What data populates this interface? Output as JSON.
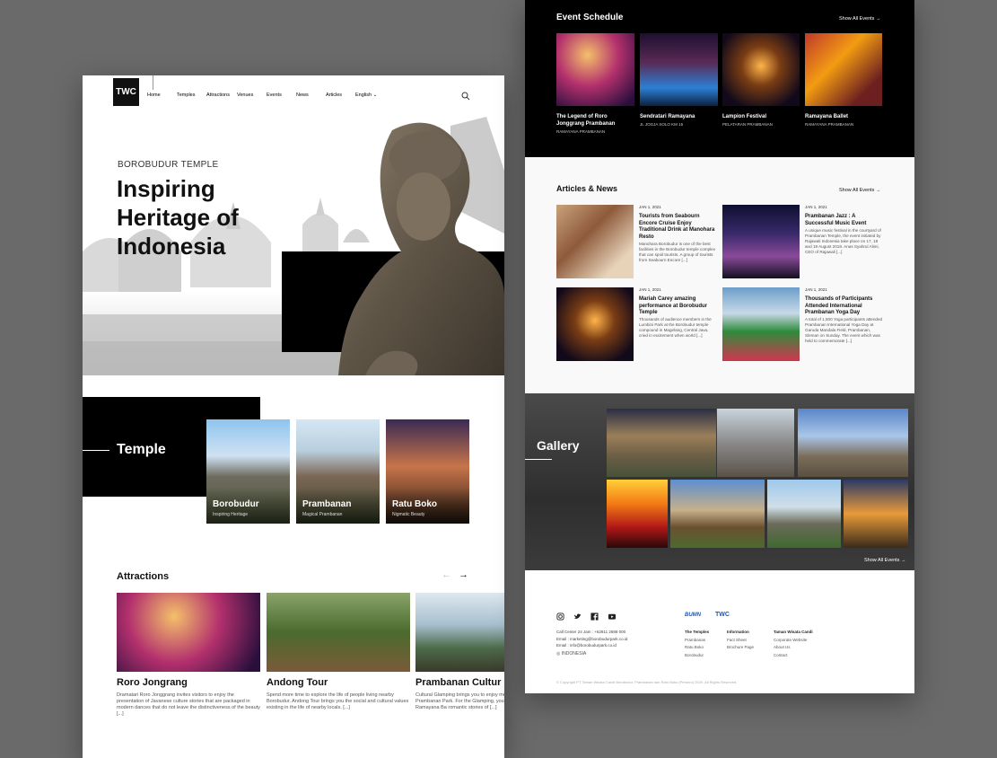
{
  "nav": {
    "logo": "TWC",
    "items": [
      "Home",
      "Temples",
      "Attractions",
      "Venues",
      "Events",
      "News",
      "Articles"
    ],
    "language": "English"
  },
  "hero": {
    "subtitle": "BOROBUDUR TEMPLE",
    "title_lines": [
      "Inspiring",
      "Heritage of",
      "Indonesia"
    ]
  },
  "temple_section": {
    "heading": "Temple",
    "cards": [
      {
        "name": "Borobudur",
        "tagline": "Inspiring Heritage"
      },
      {
        "name": "Prambanan",
        "tagline": "Magical Prambanan"
      },
      {
        "name": "Ratu Boko",
        "tagline": "Nigmatic Beauty"
      }
    ]
  },
  "attractions": {
    "heading": "Attractions",
    "items": [
      {
        "title": "Roro Jongrang",
        "desc": "Dramatari Roro Jonggrang invites visitors to enjoy the presentation of Javanese culture stories that are packaged in modern dances that do not leave the distinctiveness of the beauty [...]"
      },
      {
        "title": "Andong Tour",
        "desc": "Spend more time to explore the life of people living nearby Borobudur. Andong Tour brings you the social and cultural values existing in the life of nearby locals. [...]"
      },
      {
        "title": "Prambanan Cultur",
        "desc": "Cultural Glamping brings you to enjoy moment at Prambanan Park. For the Glamping, you will see Ramayana Ba romantic stories of [...]"
      }
    ]
  },
  "events": {
    "heading": "Event Schedule",
    "show_all": "Show All Events",
    "items": [
      {
        "title": "The Legend of Roro Jonggrang Prambanan",
        "place": "RAMAYANA PRAMBANAN"
      },
      {
        "title": "Sendratari Ramayana",
        "place": "JL JOGJA SOLO KM 16"
      },
      {
        "title": "Lampion Festival",
        "place": "PELATARAN PRAMBANAN"
      },
      {
        "title": "Ramayana Ballet",
        "place": "RAMAYANA PRAMBANAN"
      }
    ]
  },
  "articles": {
    "heading": "Articles & News",
    "show_all": "Show All Events",
    "items": [
      {
        "date": "JAN 1, 2021",
        "title": "Tourists from Seabourn Encore Cruise Enjoy Traditional Drink at Manohara Resto",
        "desc": "Manohara Borobudur is one of the best facilities in the Borobudur temple complex that can spoil tourists. A group of tourists from Seabourn Encore [...]"
      },
      {
        "date": "JAN 1, 2021",
        "title": "Prambanan Jazz : A Successful Music Event",
        "desc": "A unique music festival in the courtyard of Prambanan Temple, the event initiated by Rajawali Indonesia take place on 17, 18 and 19 August 2018. Anas Syahrul Alimi, CEO of Rajawali [...]"
      },
      {
        "date": "JAN 1, 2021",
        "title": "Mariah Carey amazing performance at Borobudur Temple",
        "desc": "Thousands of audience members in the Lumbini Park at the Borobudur temple compound in Magelang, Central Java, cried in excitement when world [...]"
      },
      {
        "date": "JAN 1, 2021",
        "title": "Thousands of Participants Attended International Prambanan Yoga Day",
        "desc": "A total of 1,500 Yoga participants attended Prambanan International Yoga Day at Garuda Mandala Field, Prambanan, Sleman on Sunday. The event which was held to commemorate [...]"
      }
    ]
  },
  "gallery": {
    "heading": "Gallery",
    "show_all": "Show All Events"
  },
  "footer": {
    "contact": [
      "Call Center 24 Jam : +62811 2688 000",
      "Email : marketing@borobudurpark.co.id",
      "Email : info@borobudurpark.co.id"
    ],
    "country": "INDONESIA",
    "cols": [
      {
        "title": "The Temples",
        "links": [
          "Prambanan",
          "Ratu Boko",
          "Borobudur"
        ]
      },
      {
        "title": "Information",
        "links": [
          "Fact Sheet",
          "Brochure Page"
        ]
      },
      {
        "title": "Taman Wisata Candi",
        "links": [
          "Corporate Website",
          "About Us",
          "Contact"
        ]
      }
    ],
    "brands": [
      "BUMN",
      "TWC"
    ],
    "copyright": "© Copyright PT Taman Wisata Candi Borobudur, Prambanan dan Ratu Boko (Persero) 2020. All Rights Reserved."
  }
}
